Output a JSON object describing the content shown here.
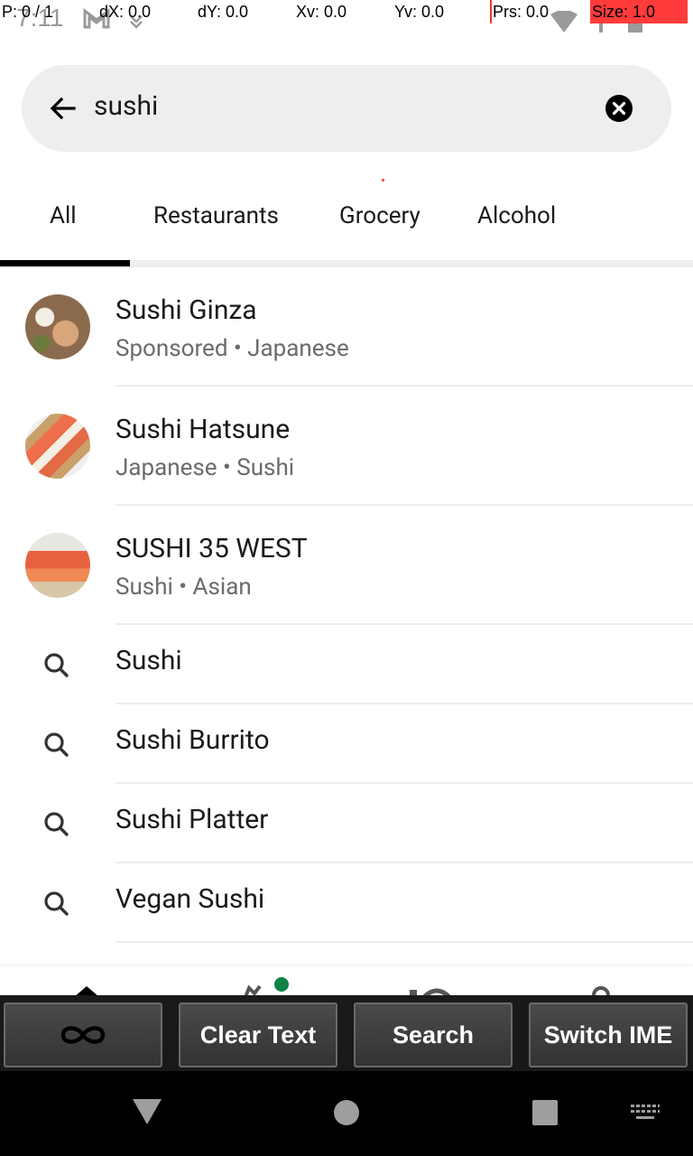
{
  "status_bar": {
    "time": "7:11"
  },
  "debug_overlay": {
    "p": "P: 0 / 1",
    "dx": "dX: 0.0",
    "dy": "dY: 0.0",
    "xv": "Xv: 0.0",
    "yv": "Yv: 0.0",
    "prs": "Prs: 0.0",
    "size": "Size: 1.0"
  },
  "search": {
    "query": "sushi",
    "back_icon": "arrow-left-icon",
    "clear_icon": "clear-circle-icon"
  },
  "tabs": [
    {
      "label": "All",
      "selected": true
    },
    {
      "label": "Restaurants",
      "selected": false
    },
    {
      "label": "Grocery",
      "selected": false
    },
    {
      "label": "Alcohol",
      "selected": false
    }
  ],
  "restaurants": [
    {
      "name": "Sushi Ginza",
      "meta": "Sponsored • Japanese"
    },
    {
      "name": "Sushi Hatsune",
      "meta": "Japanese • Sushi"
    },
    {
      "name": "SUSHI 35 WEST",
      "meta": "Sushi • Asian"
    }
  ],
  "suggestions": [
    {
      "label": "Sushi"
    },
    {
      "label": "Sushi Burrito"
    },
    {
      "label": "Sushi Platter"
    },
    {
      "label": "Vegan Sushi"
    }
  ],
  "ime_toolbar": {
    "clear_text": "Clear Text",
    "search": "Search",
    "switch_ime": "Switch IME"
  },
  "colors": {
    "accent": "#000000",
    "search_bg": "#eeeeee",
    "subtitle": "#6b6b6b",
    "notification_dot": "#0e8345"
  }
}
